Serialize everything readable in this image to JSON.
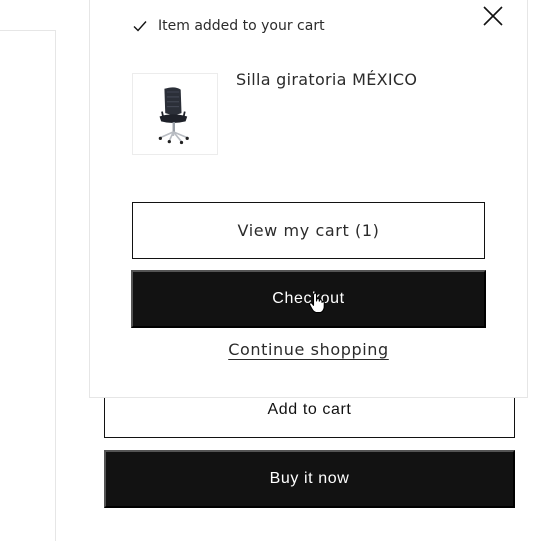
{
  "notification": {
    "message": "Item added to your cart",
    "product_name": "Silla giratoria MÉXICO",
    "view_cart_label": "View my cart (1)",
    "checkout_label": "Checkout",
    "continue_label": "Continue shopping",
    "icons": {
      "check": "check-icon",
      "close": "close-icon",
      "product_image": "office-chair-image"
    }
  },
  "product_form": {
    "add_to_cart_label": "Add to cart",
    "buy_now_label": "Buy it now"
  },
  "colors": {
    "primary": "#121212",
    "background": "#ffffff",
    "border": "#e6e6e6"
  }
}
